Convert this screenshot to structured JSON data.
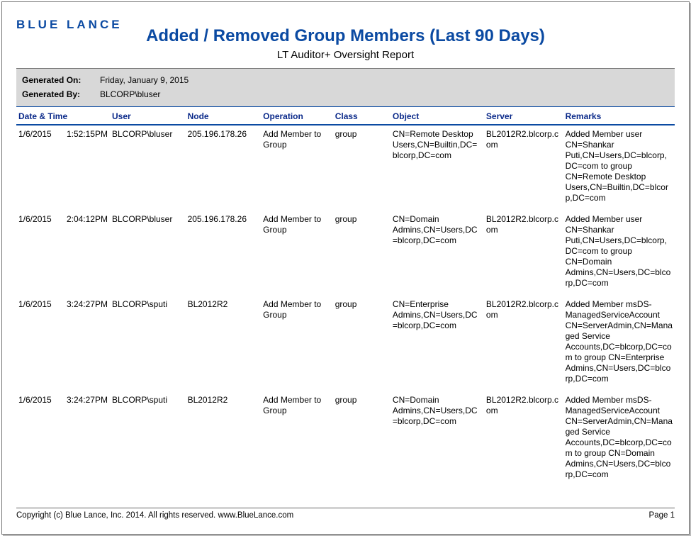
{
  "brand": "BLUE LANCE",
  "title": "Added / Removed Group Members (Last 90 Days)",
  "subtitle": "LT Auditor+ Oversight Report",
  "meta": {
    "generated_on_label": "Generated On:",
    "generated_on_value": "Friday, January 9, 2015",
    "generated_by_label": "Generated By:",
    "generated_by_value": "BLCORP\\bluser"
  },
  "columns": {
    "datetime": "Date & Time",
    "user": "User",
    "node": "Node",
    "operation": "Operation",
    "class": "Class",
    "object": "Object",
    "server": "Server",
    "remarks": "Remarks"
  },
  "rows": [
    {
      "date": "1/6/2015",
      "time": "1:52:15PM",
      "user": "BLCORP\\bluser",
      "node": "205.196.178.26",
      "operation": "Add Member to Group",
      "class": "group",
      "object": "CN=Remote Desktop Users,CN=Builtin,DC=blcorp,DC=com",
      "server": "BL2012R2.blcorp.com",
      "remarks": "Added Member user CN=Shankar Puti,CN=Users,DC=blcorp,DC=com to group CN=Remote Desktop Users,CN=Builtin,DC=blcorp,DC=com"
    },
    {
      "date": "1/6/2015",
      "time": "2:04:12PM",
      "user": "BLCORP\\bluser",
      "node": "205.196.178.26",
      "operation": "Add Member to Group",
      "class": "group",
      "object": "CN=Domain Admins,CN=Users,DC=blcorp,DC=com",
      "server": "BL2012R2.blcorp.com",
      "remarks": "Added Member user CN=Shankar Puti,CN=Users,DC=blcorp,DC=com to group CN=Domain Admins,CN=Users,DC=blcorp,DC=com"
    },
    {
      "date": "1/6/2015",
      "time": "3:24:27PM",
      "user": "BLCORP\\sputi",
      "node": "BL2012R2",
      "operation": "Add Member to Group",
      "class": "group",
      "object": "CN=Enterprise Admins,CN=Users,DC=blcorp,DC=com",
      "server": "BL2012R2.blcorp.com",
      "remarks": "Added Member msDS-ManagedServiceAccount CN=ServerAdmin,CN=Managed Service Accounts,DC=blcorp,DC=com to group CN=Enterprise Admins,CN=Users,DC=blcorp,DC=com"
    },
    {
      "date": "1/6/2015",
      "time": "3:24:27PM",
      "user": "BLCORP\\sputi",
      "node": "BL2012R2",
      "operation": "Add Member to Group",
      "class": "group",
      "object": "CN=Domain Admins,CN=Users,DC=blcorp,DC=com",
      "server": "BL2012R2.blcorp.com",
      "remarks": "Added Member msDS-ManagedServiceAccount CN=ServerAdmin,CN=Managed Service Accounts,DC=blcorp,DC=com to group CN=Domain Admins,CN=Users,DC=blcorp,DC=com"
    }
  ],
  "footer": {
    "copyright": "Copyright (c) Blue Lance, Inc. 2014. All rights reserved. www.BlueLance.com",
    "page": "Page 1"
  }
}
